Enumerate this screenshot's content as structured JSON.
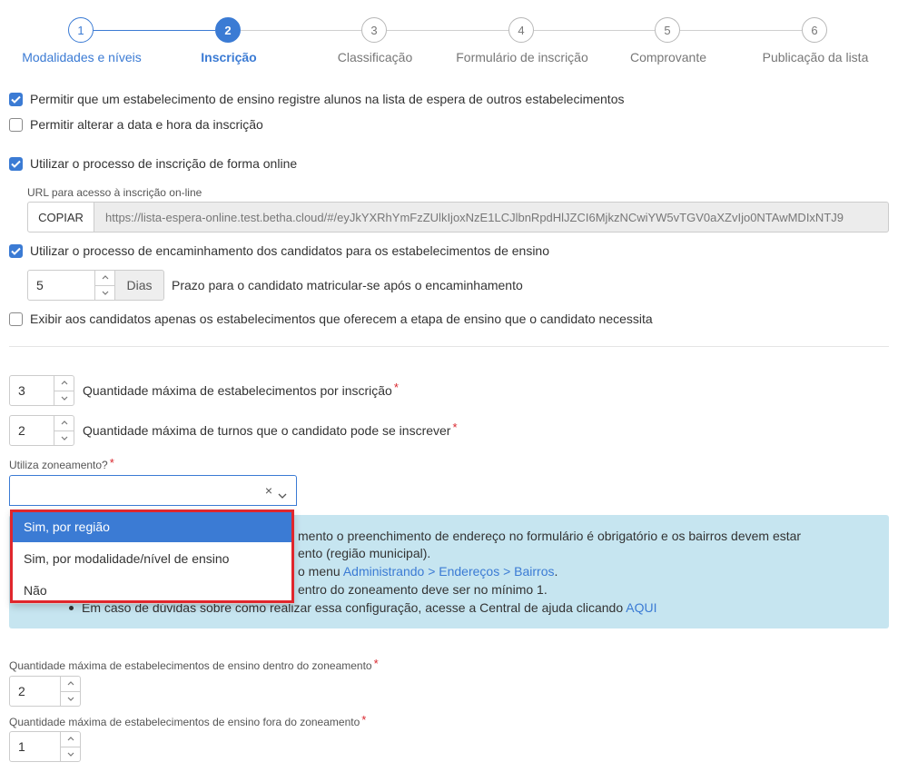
{
  "stepper": {
    "steps": [
      {
        "number": "1",
        "label": "Modalidades e níveis",
        "state": "done"
      },
      {
        "number": "2",
        "label": "Inscrição",
        "state": "active"
      },
      {
        "number": "3",
        "label": "Classificação",
        "state": "todo"
      },
      {
        "number": "4",
        "label": "Formulário de inscrição",
        "state": "todo"
      },
      {
        "number": "5",
        "label": "Comprovante",
        "state": "todo"
      },
      {
        "number": "6",
        "label": "Publicação da lista",
        "state": "todo"
      }
    ]
  },
  "options": {
    "allow_waitlist_other": {
      "label": "Permitir que um estabelecimento de ensino registre alunos na lista de espera de outros estabelecimentos",
      "checked": true
    },
    "allow_change_datetime": {
      "label": "Permitir alterar a data e hora da inscrição",
      "checked": false
    },
    "online_process": {
      "label": "Utilizar o processo de inscrição de forma online",
      "checked": true
    },
    "forwarding_process": {
      "label": "Utilizar o processo de encaminhamento dos candidatos para os estabelecimentos de ensino",
      "checked": true
    },
    "show_only_matching": {
      "label": "Exibir aos candidatos apenas os estabelecimentos que oferecem a etapa de ensino que o candidato necessita",
      "checked": false
    }
  },
  "url_section": {
    "label": "URL para acesso à inscrição on-line",
    "copy_label": "COPIAR",
    "url": "https://lista-espera-online.test.betha.cloud/#/eyJkYXRhYmFzZUlkIjoxNzE1LCJlbnRpdHlJZCI6MjkzNCwiYW5vTGV0aXZvIjo0NTAwMDIxNTJ9"
  },
  "deadline": {
    "value": "5",
    "unit": "Dias",
    "label": "Prazo para o candidato matricular-se após o encaminhamento"
  },
  "max_establishments": {
    "value": "3",
    "label": "Quantidade máxima de estabelecimentos por inscrição",
    "required_mark": "*"
  },
  "max_shifts": {
    "value": "2",
    "label": "Quantidade máxima de turnos que o candidato pode se inscrever",
    "required_mark": "*"
  },
  "zoning": {
    "label": "Utiliza zoneamento?",
    "required_mark": "*",
    "clear_glyph": "×",
    "options": [
      "Sim, por região",
      "Sim, por modalidade/nível de ensino",
      "Não"
    ],
    "highlighted_index": 0
  },
  "info": {
    "line1": "mento o preenchimento de endereço no formulário é obrigatório e os bairros devem estar",
    "line2": "ento (região municipal).",
    "line3_prefix": "o menu ",
    "line3_link": "Administrando > Endereços > Bairros",
    "line3_suffix": ".",
    "line4": "entro do zoneamento deve ser no mínimo 1.",
    "line5_text": "Em caso de dúvidas sobre como realizar essa configuração, acesse a Central de ajuda clicando ",
    "line5_link": "AQUI"
  },
  "inside_zone": {
    "label": "Quantidade máxima de estabelecimentos de ensino dentro do zoneamento",
    "required_mark": "*",
    "value": "2"
  },
  "outside_zone": {
    "label": "Quantidade máxima de estabelecimentos de ensino fora do zoneamento",
    "required_mark": "*",
    "value": "1"
  },
  "colors": {
    "accent": "#3b7bd4",
    "info_bg": "#c6e5f0",
    "highlight_frame": "#e0262c",
    "required": "#d9262d"
  }
}
